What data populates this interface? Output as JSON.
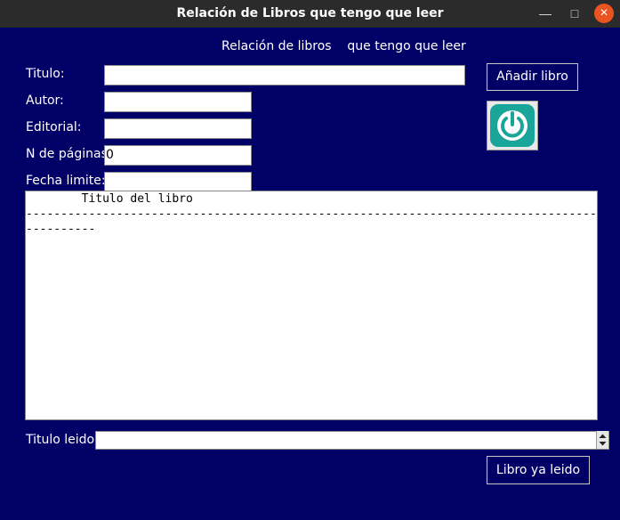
{
  "window": {
    "title": "Relación de Libros que tengo que leer"
  },
  "heading": "Relación de libros    que tengo que leer",
  "form": {
    "titulo_label": "Titulo:",
    "titulo_value": "",
    "autor_label": "Autor:",
    "autor_value": "",
    "editorial_label": "Editorial:",
    "editorial_value": "",
    "paginas_label": "N de páginas:",
    "paginas_value": "0",
    "fecha_label": "Fecha limite:",
    "fecha_value": ""
  },
  "buttons": {
    "add_label": "Añadir libro",
    "read_label": "Libro ya leido"
  },
  "list": {
    "lines": [
      "        Titulo del libro",
      "------------------------------------------------------------------------------------------",
      "----------"
    ]
  },
  "bottom": {
    "leido_label": "Titulo leido:",
    "leido_value": ""
  },
  "icons": {
    "power": "power-icon",
    "minimize": "minimize-icon",
    "maximize": "maximize-icon",
    "close": "close-icon"
  },
  "colors": {
    "background": "#000066",
    "power_accent": "#1aa59a"
  }
}
